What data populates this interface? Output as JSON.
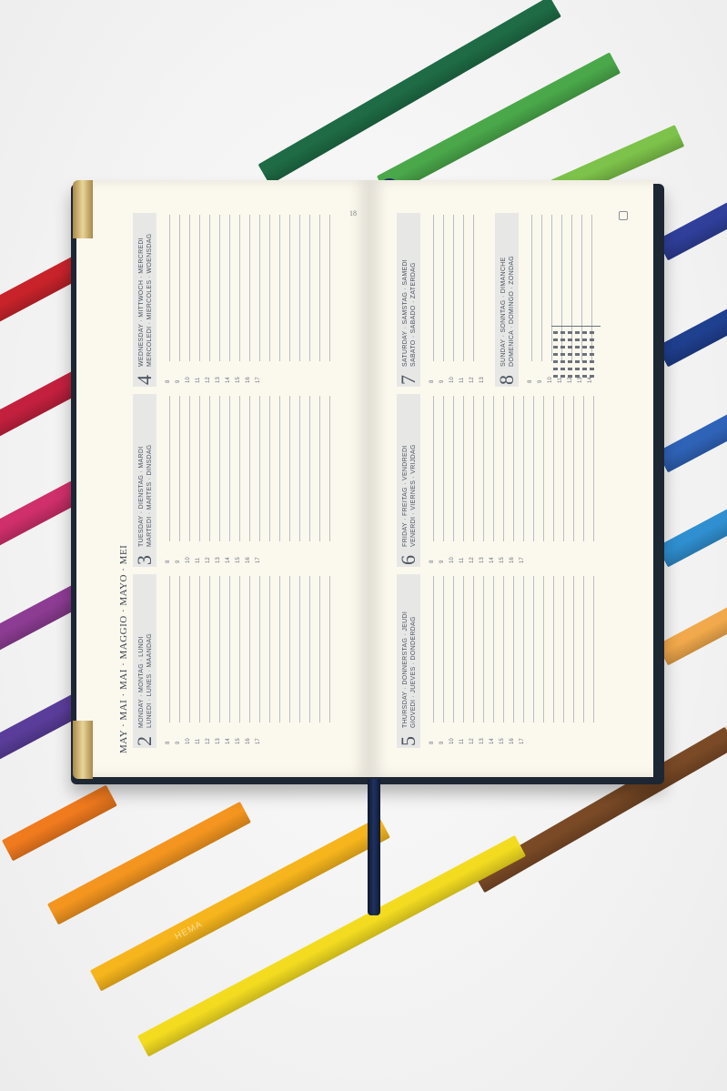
{
  "pencils": [
    {
      "name": "dark-green-pencil",
      "color": "#1e6b45"
    },
    {
      "name": "green-pencil",
      "color": "#4aa84a"
    },
    {
      "name": "light-green-pencil",
      "color": "#7dc24a"
    },
    {
      "name": "red-pencil",
      "color": "#c8232b"
    },
    {
      "name": "crimson-pencil",
      "color": "#c3203e"
    },
    {
      "name": "magenta-pencil",
      "color": "#cf2f6a"
    },
    {
      "name": "purple-pencil",
      "color": "#8d3c93"
    },
    {
      "name": "violet-pencil",
      "color": "#5a3d9a"
    },
    {
      "name": "indigo-pencil",
      "color": "#2f3f9a"
    },
    {
      "name": "navy-pencil",
      "color": "#1f3f8f"
    },
    {
      "name": "blue-pencil",
      "color": "#2f63b8"
    },
    {
      "name": "sky-blue-pencil",
      "color": "#2f8fd0"
    },
    {
      "name": "peach-pencil",
      "color": "#f1a94b"
    },
    {
      "name": "brown-pencil",
      "color": "#7a4a26"
    },
    {
      "name": "orange-pencil",
      "color": "#f07a1e"
    },
    {
      "name": "dark-orange-pencil",
      "color": "#f3951f"
    },
    {
      "name": "amber-pencil",
      "color": "#f6b51c",
      "brand": "HEMA"
    },
    {
      "name": "yellow-pencil",
      "color": "#f3dc20"
    }
  ],
  "planner": {
    "cover_color": "#1d2633",
    "ribbon_color": "#1f3160",
    "left_page": {
      "page_number": "18",
      "month_header": "MAY · MAI · MAI · MAGGIO · MAYO · MEI",
      "days": [
        {
          "number": "2",
          "line1": "MONDAY · MONTAG · LUNDI",
          "line2": "LUNEDI · LUNES · MAANDAG"
        },
        {
          "number": "3",
          "line1": "TUESDAY · DIENSTAG · MARDI",
          "line2": "MARTEDI · MARTES · DINSDAG"
        },
        {
          "number": "4",
          "line1": "WEDNESDAY · MITTWOCH · MERCREDI",
          "line2": "MERCOLEDI · MIERCOLES · WOENSDAG"
        }
      ]
    },
    "right_page": {
      "days": [
        {
          "number": "5",
          "line1": "THURSDAY · DONNERSTAG · JEUDI",
          "line2": "GIOVEDI · JUEVES · DONDERDAG"
        },
        {
          "number": "6",
          "line1": "FRIDAY · FREITAG · VENDREDI",
          "line2": "VENERDI · VIERNES · VRIJDAG"
        },
        {
          "number": "7",
          "line1": "SATURDAY · SAMSTAG · SAMEDI",
          "line2": "SABATO · SABADO · ZATERDAG"
        },
        {
          "number": "8",
          "line1": "SUNDAY · SONNTAG · DIMANCHE",
          "line2": "DOMENICA · DOMINGO · ZONDAG"
        }
      ]
    },
    "hours": [
      "8",
      "9",
      "10",
      "11",
      "12",
      "13",
      "14",
      "15",
      "16",
      "17"
    ]
  }
}
